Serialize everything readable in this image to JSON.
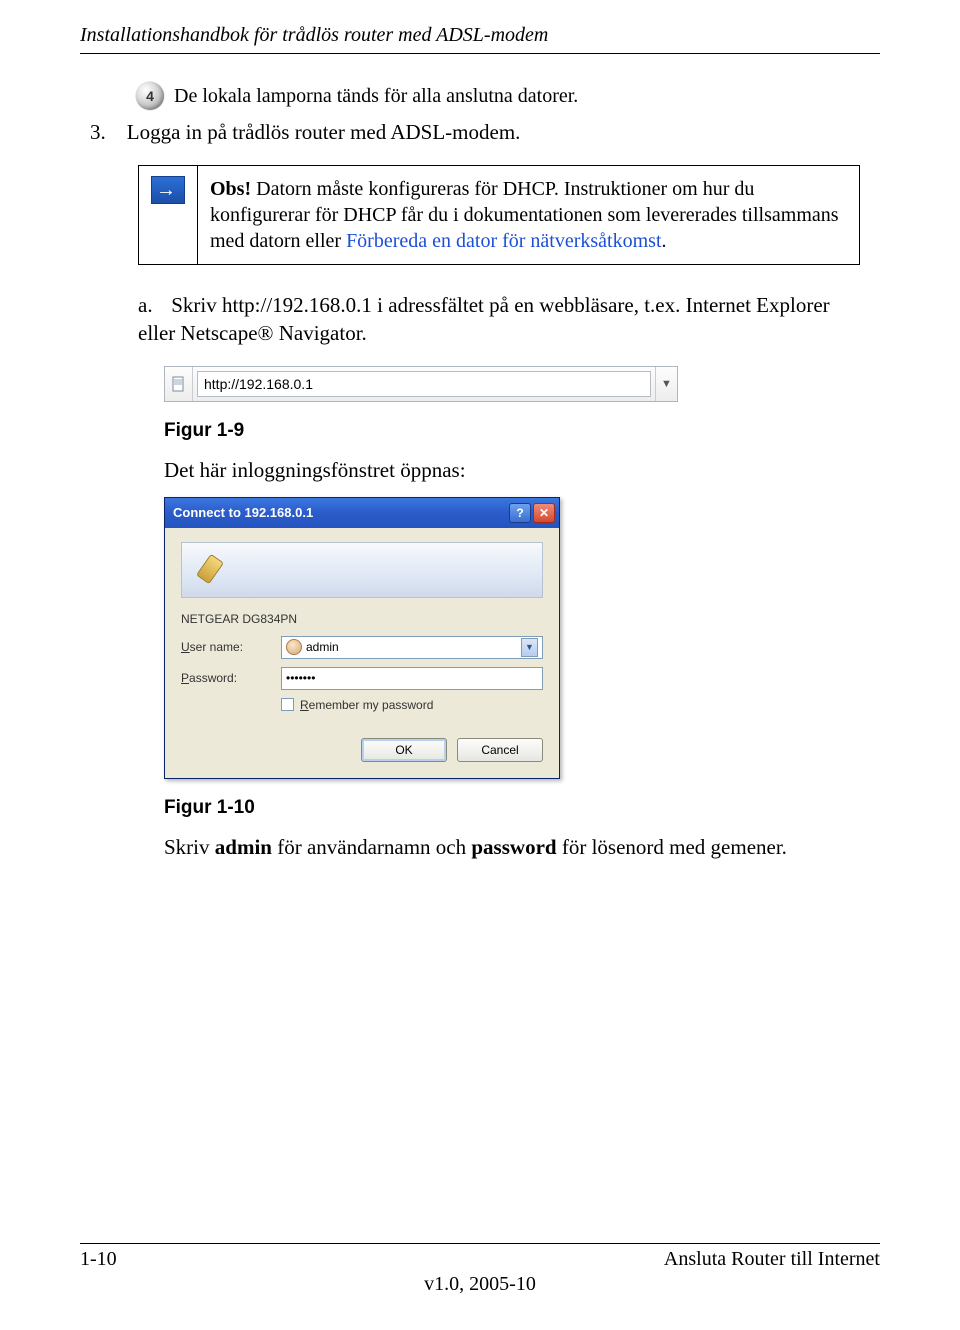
{
  "header": {
    "title": "Installationshandbok för trådlös router med ADSL-modem"
  },
  "step_led": {
    "badge": "4",
    "text": "De lokala lamporna tänds för alla anslutna datorer."
  },
  "step3": {
    "number": "3.",
    "text": "Logga in på trådlös router med ADSL-modem."
  },
  "note": {
    "lead": "Obs!",
    "body": " Datorn måste konfigureras för DHCP. Instruktioner om hur du konfigurerar för DHCP får du i dokumentationen som levererades tillsammans med datorn eller ",
    "link": "Förbereda en dator för nätverksåtkomst",
    "tail": "."
  },
  "substep_a": {
    "letter": "a.",
    "text": "Skriv http://192.168.0.1 i adressfältet på en webbläsare, t.ex. Internet Explorer eller Netscape® Navigator."
  },
  "addressbar": {
    "value": "http://192.168.0.1"
  },
  "fig1": {
    "caption": "Figur 1-9"
  },
  "after_fig1": "Det här inloggningsfönstret öppnas:",
  "dialog": {
    "title": "Connect to 192.168.0.1",
    "device": "NETGEAR DG834PN",
    "labels": {
      "user": "User name:",
      "pass": "Password:"
    },
    "username": "admin",
    "password": "•••••••",
    "remember_pre": "R",
    "remember_rest": "emember my password",
    "ok": "OK",
    "cancel": "Cancel"
  },
  "fig2": {
    "caption": "Figur 1-10"
  },
  "final": {
    "pre": "Skriv ",
    "b1": "admin",
    "mid": " för användarnamn och ",
    "b2": "password",
    "post": " för lösenord med gemener."
  },
  "footer": {
    "left": "1-10",
    "right": "Ansluta Router till Internet",
    "version": "v1.0, 2005-10"
  }
}
